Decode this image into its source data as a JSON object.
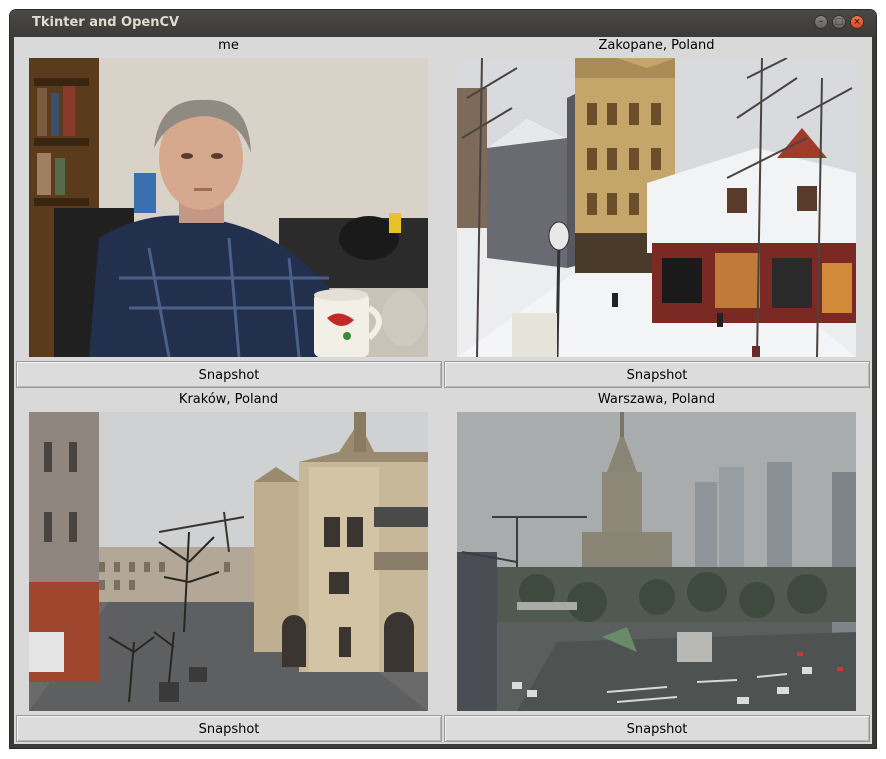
{
  "window": {
    "title": "Tkinter and OpenCV"
  },
  "panels": [
    {
      "label": "me",
      "button": "Snapshot"
    },
    {
      "label": "Zakopane, Poland",
      "button": "Snapshot"
    },
    {
      "label": "Kraków, Poland",
      "button": "Snapshot"
    },
    {
      "label": "Warszawa, Poland",
      "button": "Snapshot"
    }
  ],
  "icons": {
    "minimize": "minimize-icon",
    "maximize": "maximize-icon",
    "close": "close-icon"
  }
}
